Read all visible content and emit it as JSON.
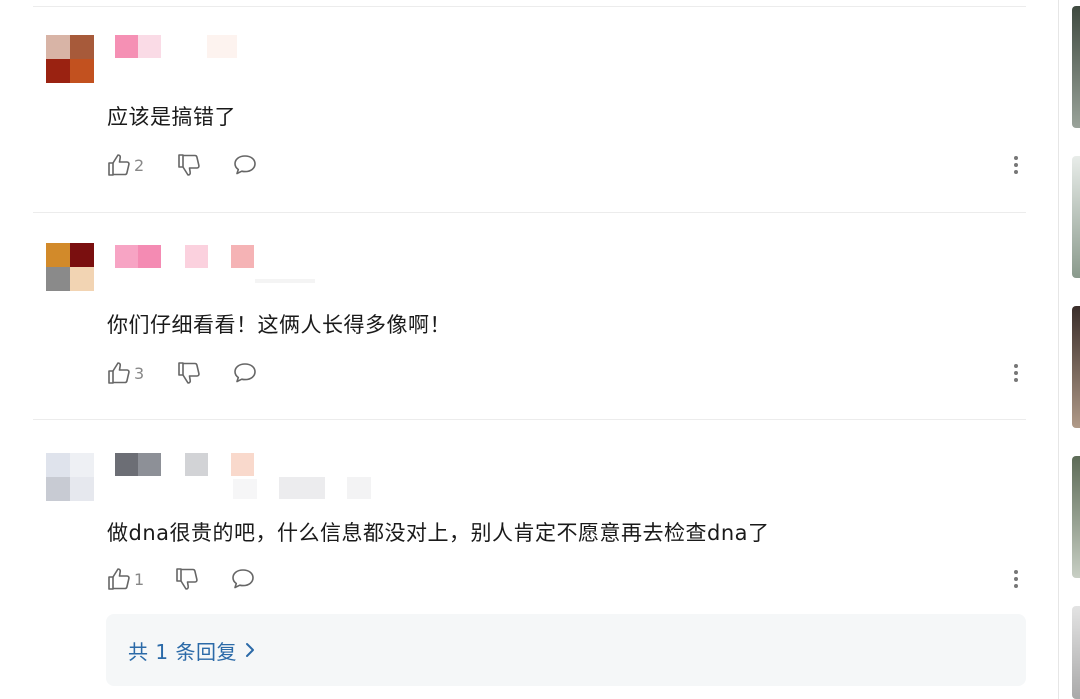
{
  "colors": {
    "text": "#1a1a1a",
    "meta": "#888888",
    "link": "#2b6aa8",
    "reply_bg": "#f5f7f8",
    "divider": "#ececec"
  },
  "comments": [
    {
      "text": "应该是搞错了",
      "likes": "2",
      "avatar_colors": [
        "#d8b4a6",
        "#a75a3a",
        "#9a2211",
        "#c2511f"
      ]
    },
    {
      "text": "你们仔细看看！这俩人长得多像啊！",
      "likes": "3",
      "avatar_colors": [
        "#d28a2a",
        "#7a0f0f",
        "#8a8a8a",
        "#f2d4b3"
      ]
    },
    {
      "text": "做dna很贵的吧，什么信息都没对上，别人肯定不愿意再去检查dna了",
      "likes": "1",
      "avatar_colors": [
        "#dfe3ec",
        "#eef0f4",
        "#c8cbd3",
        "#e6e8ee"
      ]
    }
  ],
  "reply_summary": {
    "label": "共 1 条回复",
    "chevron_icon": "chevron-right-icon"
  },
  "icons": {
    "like": "thumbs-up-icon",
    "dislike": "thumbs-down-icon",
    "reply": "speech-bubble-icon",
    "more": "more-vertical-icon"
  }
}
